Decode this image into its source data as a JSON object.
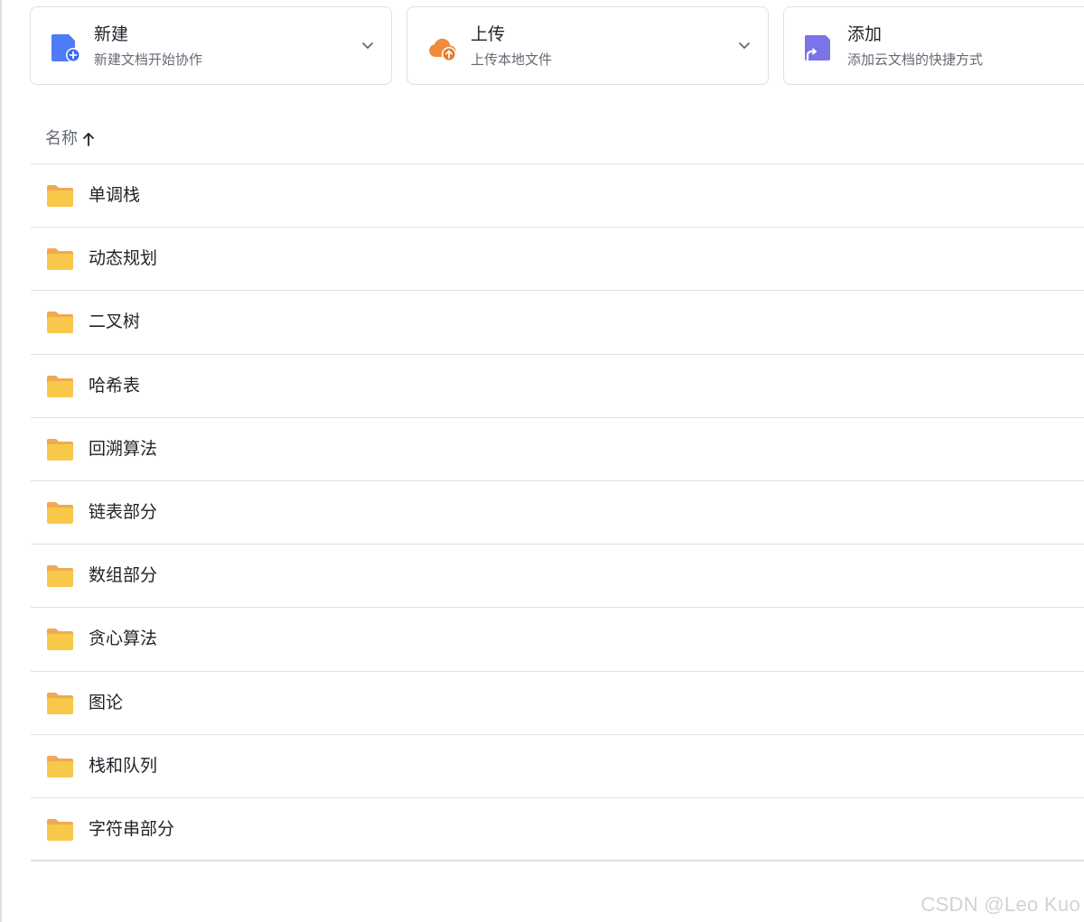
{
  "actions": {
    "new": {
      "title": "新建",
      "subtitle": "新建文档开始协作",
      "icon": "new-doc-icon",
      "color": "#4e7cf6"
    },
    "upload": {
      "title": "上传",
      "subtitle": "上传本地文件",
      "icon": "upload-cloud-icon",
      "color": "#f08a3c"
    },
    "add": {
      "title": "添加",
      "subtitle": "添加云文档的快捷方式",
      "icon": "shortcut-doc-icon",
      "color": "#7b73e8"
    }
  },
  "list": {
    "header": {
      "name_label": "名称",
      "sort": "ascending"
    },
    "items": [
      {
        "name": "单调栈",
        "type": "folder"
      },
      {
        "name": "动态规划",
        "type": "folder"
      },
      {
        "name": "二叉树",
        "type": "folder"
      },
      {
        "name": "哈希表",
        "type": "folder"
      },
      {
        "name": "回溯算法",
        "type": "folder"
      },
      {
        "name": "链表部分",
        "type": "folder"
      },
      {
        "name": "数组部分",
        "type": "folder"
      },
      {
        "name": "贪心算法",
        "type": "folder"
      },
      {
        "name": "图论",
        "type": "folder"
      },
      {
        "name": "栈和队列",
        "type": "folder"
      },
      {
        "name": "字符串部分",
        "type": "folder"
      }
    ]
  },
  "watermark": "CSDN @Leo Kuo",
  "colors": {
    "folder": "#f8c84a",
    "folder_tab": "#f0a952",
    "divider": "#dee0e3"
  }
}
